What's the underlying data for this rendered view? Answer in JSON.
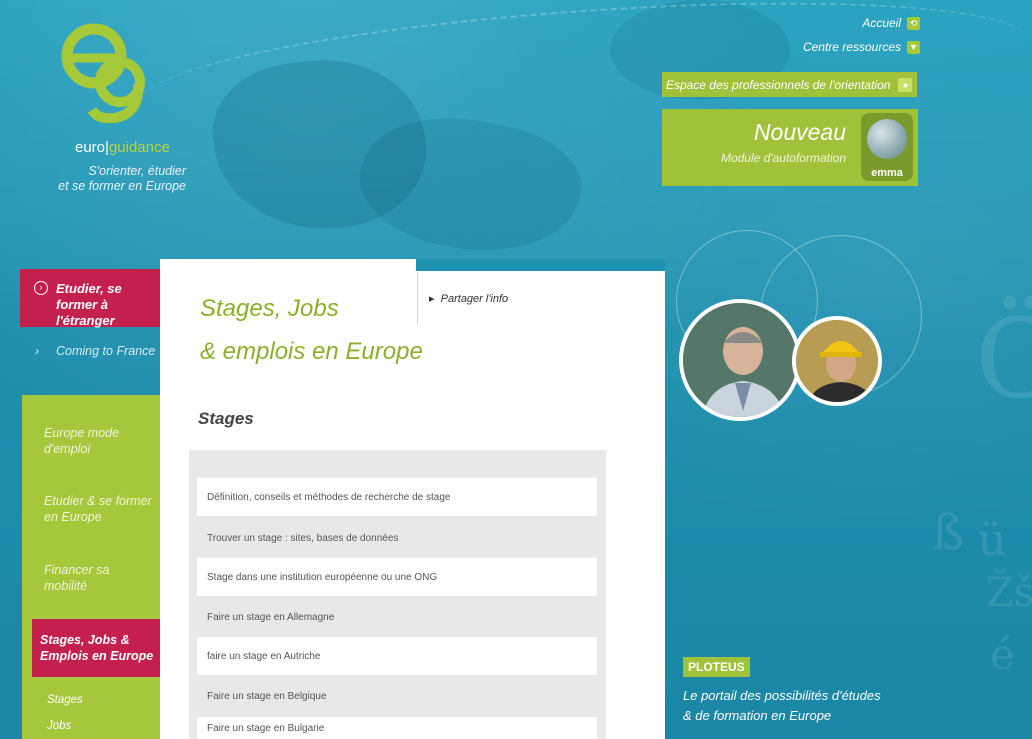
{
  "brand": {
    "logo_text": "eg",
    "name_part1": "euro",
    "name_sep": "|",
    "name_part2": "guidance",
    "tagline_line1": "S'orienter, étudier",
    "tagline_line2": "et se former en Europe"
  },
  "top_nav": {
    "home": "Accueil",
    "resources": "Centre ressources",
    "professionals": "Espace des professionnels de l'orientation"
  },
  "promo": {
    "title": "Nouveau",
    "subtitle": "Module d'autoformation",
    "badge": "emma"
  },
  "left_nav": {
    "study_abroad": "Etudier, se former à l'étranger",
    "coming": "Coming to France",
    "items": [
      {
        "label": "Europe mode d'emploi"
      },
      {
        "label": "Etudier & se former en Europe"
      },
      {
        "label": "Financer sa mobilité"
      },
      {
        "label": "Stages, Jobs & Emplois en Europe"
      }
    ],
    "sub_items": [
      {
        "label": "Stages"
      },
      {
        "label": "Jobs"
      }
    ]
  },
  "content": {
    "title_line1": "Stages, Jobs",
    "title_line2": "& emplois en Europe",
    "share": "Partager l'info",
    "section": "Stages",
    "rows": [
      "Définition, conseils et méthodes de recherche de stage",
      "Trouver un stage : sites, bases de données",
      "Stage dans une institution européenne ou une ONG",
      "Faire un stage en Allemagne",
      "faire un stage en Autriche",
      "Faire un stage en Belgique",
      "Faire un stage en Bulgarie"
    ]
  },
  "ploteus": {
    "tag": "PLOTEUS",
    "line1": "Le portail des possibilités d'études",
    "line2": "& de formation en Europe"
  },
  "colors": {
    "accent_green": "#9fc23a",
    "accent_red": "#c4204e",
    "background_blue": "#1f8fad"
  }
}
